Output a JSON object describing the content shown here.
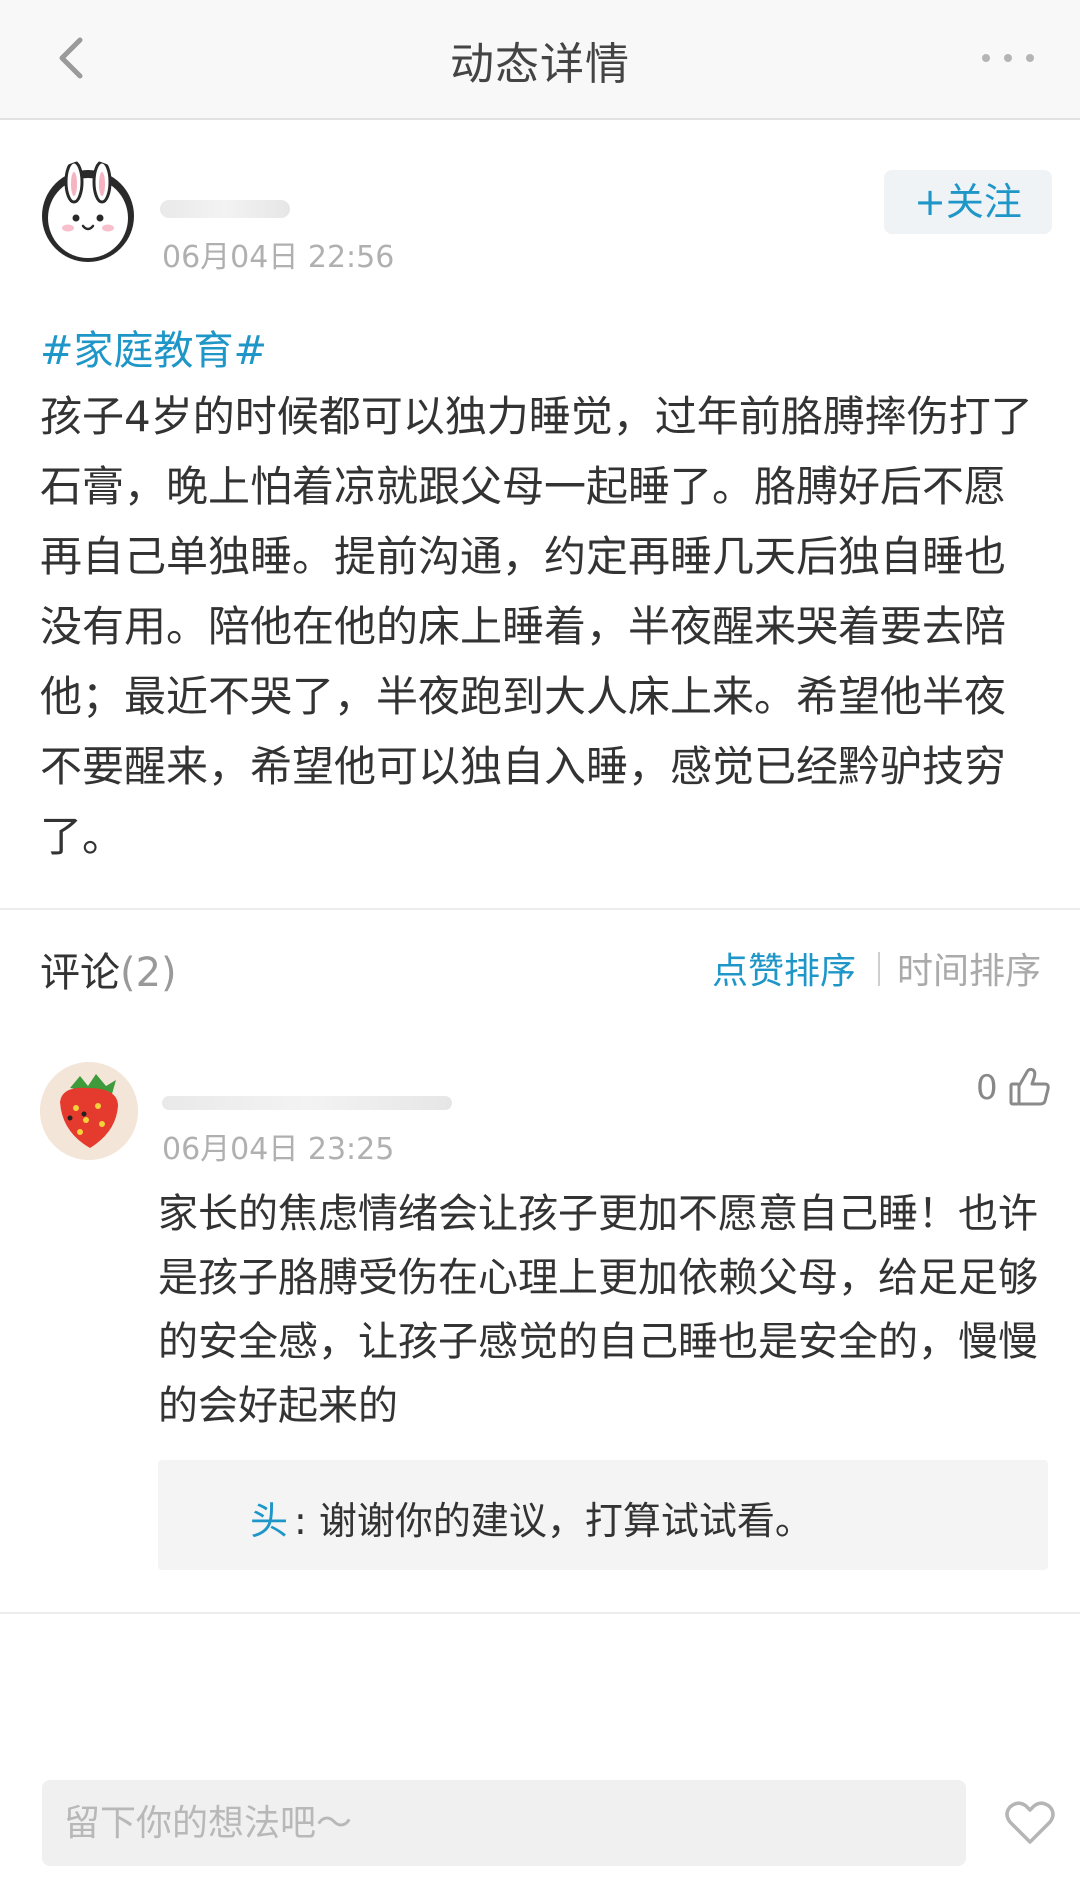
{
  "nav": {
    "title": "动态详情",
    "back_icon": "chevron-left-icon",
    "more_icon": "more-dots-icon"
  },
  "post": {
    "time": "06月04日 22:56",
    "follow_label": "+关注",
    "topic": "#家庭教育#",
    "body": "孩子4岁的时候都可以独力睡觉，过年前胳膊摔伤打了石膏，晚上怕着凉就跟父母一起睡了。胳膊好后不愿再自己单独睡。提前沟通，约定再睡几天后独自睡也没有用。陪他在他的床上睡着，半夜醒来哭着要去陪他；最近不哭了，半夜跑到大人床上来。希望他半夜不要醒来，希望他可以独自入睡，感觉已经黔驴技穷了。"
  },
  "comments": {
    "title": "评论",
    "count": "(2)",
    "sort_like": "点赞排序",
    "sort_time": "时间排序",
    "items": [
      {
        "time": "06月04日 23:25",
        "likes": "0",
        "body": "家长的焦虑情绪会让孩子更加不愿意自己睡！也许是孩子胳膊受伤在心理上更加依赖父母，给足足够的安全感，让孩子感觉的自己睡也是安全的，慢慢的会好起来的",
        "reply": {
          "name": "头",
          "text": ": 谢谢你的建议，打算试试看。"
        }
      }
    ]
  },
  "input": {
    "placeholder": "留下你的想法吧～"
  },
  "colors": {
    "accent": "#1e96c8",
    "muted": "#b0b0b0",
    "text": "#333333"
  }
}
